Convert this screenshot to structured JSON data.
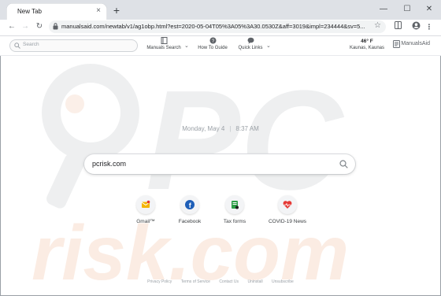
{
  "browser": {
    "tab_title": "New Tab",
    "tab_close": "×",
    "new_tab": "+",
    "window_controls": {
      "minimize": "—",
      "maximize": "☐",
      "close": "✕"
    },
    "url": "manualsaid.com/newtab/v1/ag1obp.html?est=2020-05-04T05%3A05%3A30.0530Z&aff=3019&impl=234444&sv=5...",
    "nav": {
      "back": "←",
      "forward": "→",
      "reload": "↻"
    }
  },
  "extension_bar": {
    "search_placeholder": "Search",
    "manuals_search": "Manuals Search",
    "how_to_guide": "How To Guide",
    "quick_links": "Quick Links",
    "weather_temp": "46° F",
    "weather_location": "Kaunas, Kaunas",
    "brand": "ManualsAid"
  },
  "page": {
    "date": "Monday, May 4",
    "separator": "|",
    "time": "8:37 AM",
    "search_value": "pcrisk.com",
    "tiles": [
      {
        "label": "Gmail™",
        "icon": "gmail-icon",
        "color": "#f5b400"
      },
      {
        "label": "Facebook",
        "icon": "facebook-icon",
        "color": "#1f5fb8"
      },
      {
        "label": "Tax forms",
        "icon": "tax-forms-icon",
        "color": "#2e9e48"
      },
      {
        "label": "COVID-19 News",
        "icon": "covid-news-icon",
        "color": "#e53935"
      }
    ],
    "footer": [
      "Privacy Policy",
      "Terms of Service",
      "Contact Us",
      "Uninstall",
      "Unsubscribe"
    ]
  },
  "colors": {
    "tabstrip": "#dee1e6",
    "watermark": "#f4c2a8"
  }
}
